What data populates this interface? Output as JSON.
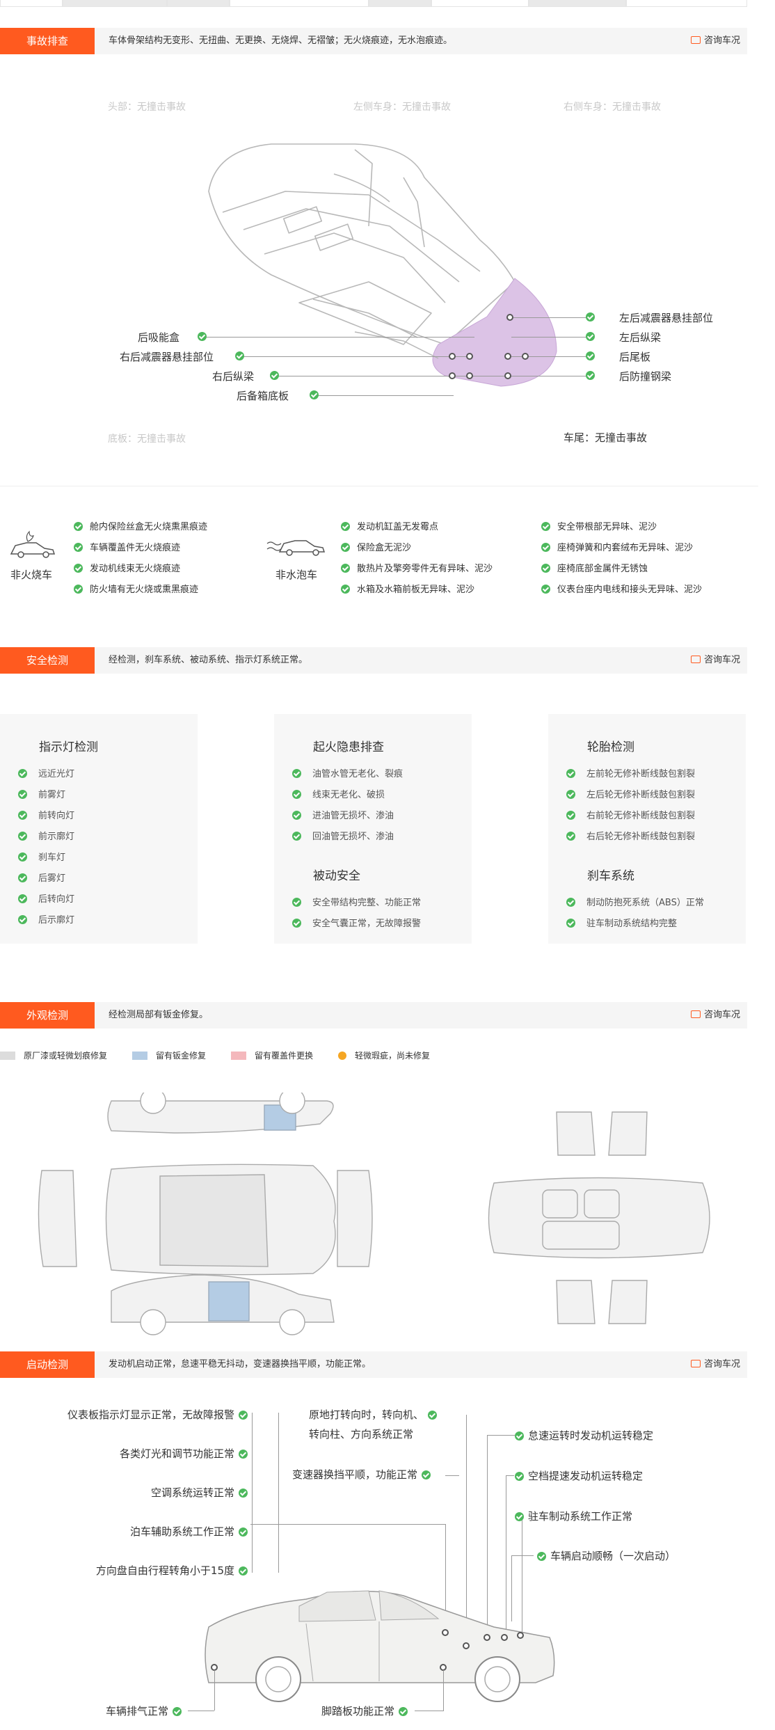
{
  "consult_label": "咨询车况",
  "accident": {
    "label": "事故排查",
    "summary": "车体骨架结构无变形、无扭曲、无更换、无烧焊、无褶皱；无火烧痕迹，无水泡痕迹。",
    "zones": {
      "head": "头部：无撞击事故",
      "left": "左侧车身：无撞击事故",
      "right": "右侧车身：无撞击事故",
      "floor": "底板：无撞击事故",
      "tail": "车尾：无撞击事故"
    },
    "left_points": [
      "后吸能盒",
      "右后减震器悬挂部位",
      "右后纵梁",
      "后备箱底板"
    ],
    "right_points": [
      "左后减震器悬挂部位",
      "左后纵梁",
      "后尾板",
      "后防撞钢梁"
    ]
  },
  "fire": {
    "label": "非火烧车",
    "items": [
      "舱内保险丝盒无火烧熏黑痕迹",
      "车辆覆盖件无火烧痕迹",
      "发动机线束无火烧痕迹",
      "防火墙有无火烧或熏黑痕迹"
    ]
  },
  "water": {
    "label": "非水泡车",
    "items": [
      "发动机缸盖无发霉点",
      "保险盒无泥沙",
      "散热片及擎旁零件无有异味、泥沙",
      "水箱及水箱前板无异味、泥沙"
    ],
    "items2": [
      "安全带根部无异味、泥沙",
      "座椅弹簧和内套绒布无异味、泥沙",
      "座椅底部金属件无锈蚀",
      "仪表台座内电线和接头无异味、泥沙"
    ]
  },
  "safety": {
    "label": "安全检测",
    "summary": "经检测，刹车系统、被动系统、指示灯系统正常。",
    "indicator": {
      "title": "指示灯检测",
      "items": [
        "远近光灯",
        "前雾灯",
        "前转向灯",
        "前示廓灯",
        "刹车灯",
        "后雾灯",
        "后转向灯",
        "后示廓灯"
      ]
    },
    "fire_hazard": {
      "title": "起火隐患排查",
      "items": [
        "油管水管无老化、裂痕",
        "线束无老化、破损",
        "进油管无损坏、渗油",
        "回油管无损坏、渗油"
      ]
    },
    "passive": {
      "title": "被动安全",
      "items": [
        "安全带结构完整、功能正常",
        "安全气囊正常，无故障报警"
      ]
    },
    "tire": {
      "title": "轮胎检测",
      "items": [
        "左前轮无修补断线鼓包割裂",
        "左后轮无修补断线鼓包割裂",
        "右前轮无修补断线鼓包割裂",
        "右后轮无修补断线鼓包割裂"
      ]
    },
    "brake": {
      "title": "刹车系统",
      "items": [
        "制动防抱死系统（ABS）正常",
        "驻车制动系统结构完整"
      ]
    }
  },
  "appearance": {
    "label": "外观检测",
    "summary": "经检测局部有钣金修复。",
    "legend": [
      {
        "text": "原厂漆或轻微划痕修复",
        "color": "#dcdcdc"
      },
      {
        "text": "留有钣金修复",
        "color": "#b4cce4"
      },
      {
        "text": "留有覆盖件更换",
        "color": "#f4b8bc"
      },
      {
        "text": "轻微瑕疵，尚未修复",
        "color": "#f5a623"
      }
    ]
  },
  "startup": {
    "label": "启动检测",
    "summary": "发动机启动正常，怠速平稳无抖动，变速器换挡平顺，功能正常。",
    "left": [
      "仪表板指示灯显示正常，无故障报警",
      "各类灯光和调节功能正常",
      "空调系统运转正常",
      "泊车辅助系统工作正常",
      "方向盘自由行程转角小于15度"
    ],
    "mid1": "原地打转向时，转向机、",
    "mid1b": "转向柱、方向系统正常",
    "mid2": "变速器换挡平顺，功能正常",
    "right": [
      "怠速运转时发动机运转稳定",
      "空档提速发动机运转稳定",
      "驻车制动系统工作正常",
      "车辆启动顺畅（一次启动）"
    ],
    "exhaust": "车辆排气正常",
    "pedal": "脚踏板功能正常"
  }
}
